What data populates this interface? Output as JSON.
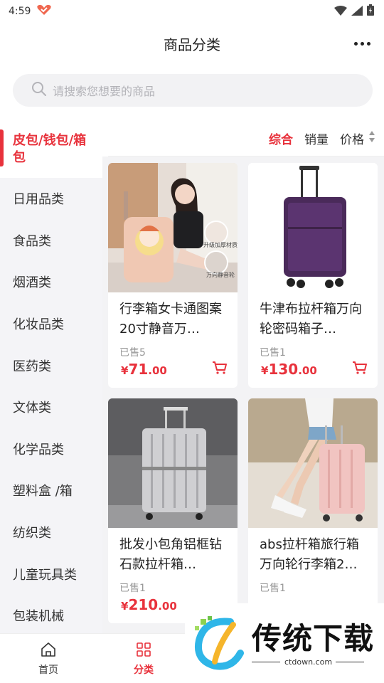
{
  "status": {
    "time": "4:59"
  },
  "header": {
    "title": "商品分类"
  },
  "search": {
    "placeholder": "请搜索您想要的商品"
  },
  "sidebar": {
    "items": [
      {
        "label": "皮包/钱包/箱包",
        "active": true
      },
      {
        "label": "日用品类"
      },
      {
        "label": "食品类"
      },
      {
        "label": "烟酒类"
      },
      {
        "label": "化妆品类"
      },
      {
        "label": "医药类"
      },
      {
        "label": "文体类"
      },
      {
        "label": "化学品类"
      },
      {
        "label": "塑料盒 /箱"
      },
      {
        "label": "纺织类"
      },
      {
        "label": "儿童玩具类"
      },
      {
        "label": "包装机械"
      }
    ]
  },
  "sort": {
    "options": [
      "综合",
      "销量",
      "价格"
    ],
    "active": "综合"
  },
  "products": [
    {
      "name": "行李箱女卡通图案20寸静音万…",
      "sold": "已售5",
      "price_int": "71",
      "price_dec": ".00",
      "yen": "¥",
      "badge1": "升级加厚材质",
      "badge2": "万向静音轮"
    },
    {
      "name": "牛津布拉杆箱万向轮密码箱子…",
      "sold": "已售1",
      "price_int": "130",
      "price_dec": ".00",
      "yen": "¥"
    },
    {
      "name": "批发小包角铝框钻石款拉杆箱…",
      "sold": "已售1",
      "price_int": "210",
      "price_dec": ".00",
      "yen": "¥"
    },
    {
      "name": "abs拉杆箱旅行箱万向轮行李箱2…",
      "sold": "已售1",
      "price_int": "",
      "price_dec": "",
      "yen": ""
    }
  ],
  "tabbar": {
    "items": [
      {
        "label": "首页"
      },
      {
        "label": "分类"
      }
    ]
  },
  "watermark": {
    "text": "传统下载",
    "url": "ctdown.com"
  },
  "colors": {
    "accent": "#e8323c"
  }
}
